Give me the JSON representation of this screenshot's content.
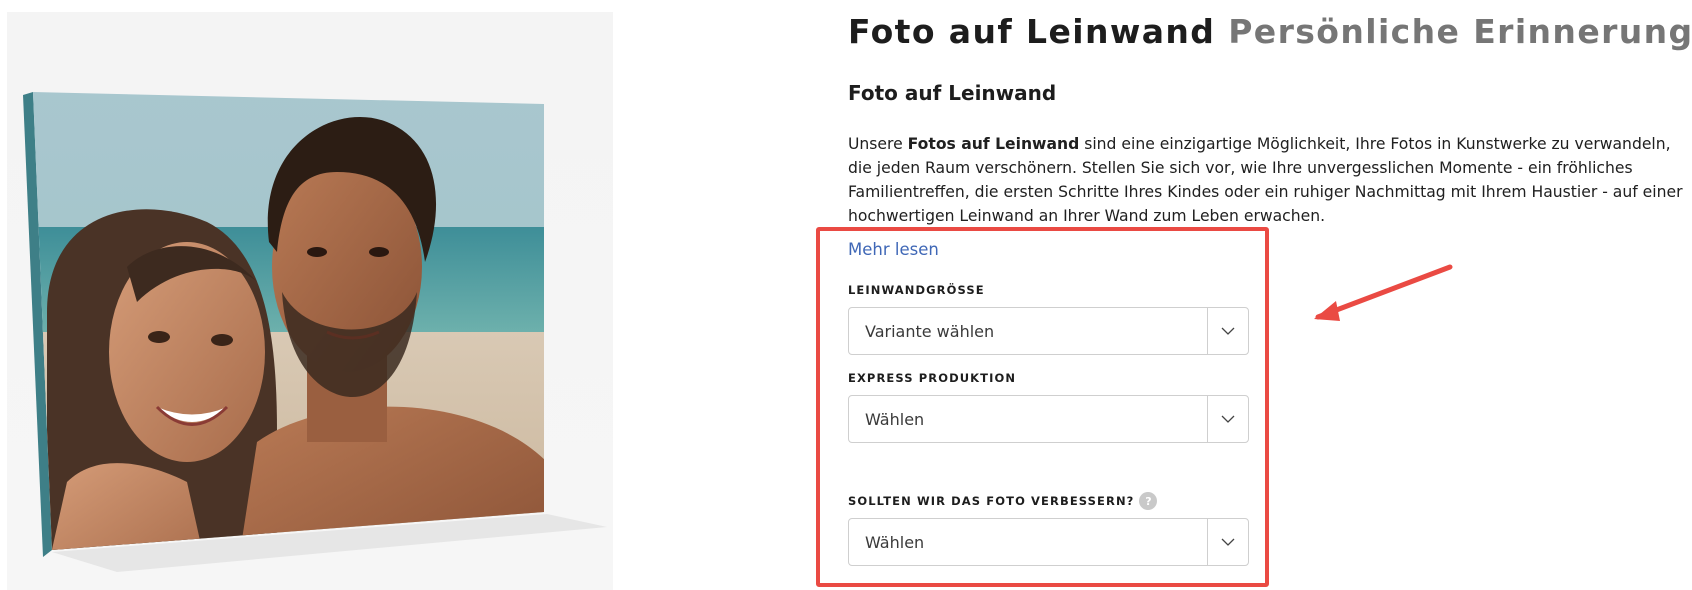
{
  "header": {
    "title_main": "Foto auf Leinwand",
    "title_sub": "Persönliche Erinnerungen"
  },
  "content": {
    "subtitle": "Foto auf Leinwand",
    "description_before": "Unsere ",
    "description_bold": "Fotos auf Leinwand",
    "description_after": " sind eine einzigartige Möglichkeit, Ihre Fotos in Kunstwerke zu verwandeln, die jeden Raum verschönern. Stellen Sie sich vor, wie Ihre unvergesslichen Momente - ein fröhliches Familientreffen, die ersten Schritte Ihres Kindes oder ein ruhiger Nachmittag mit Ihrem Haustier - auf einer hochwertigen Leinwand an Ihrer Wand zum Leben erwachen.",
    "read_more": "Mehr lesen"
  },
  "options": {
    "canvas_size": {
      "label": "LEINWANDGRÖSSE",
      "value": "Variante wählen"
    },
    "express": {
      "label": "EXPRESS PRODUKTION",
      "value": "Wählen"
    },
    "improve": {
      "label": "SOLLTEN WIR DAS FOTO VERBESSERN?",
      "help": "?",
      "value": "Wählen"
    }
  },
  "icons": {
    "dropdown": "chevron-down-icon",
    "help": "question-circle-icon",
    "annotation_arrow": "arrow-icon"
  },
  "colors": {
    "highlight": "#ea4a43",
    "link": "#3f67b6",
    "title_sub": "#767676"
  }
}
